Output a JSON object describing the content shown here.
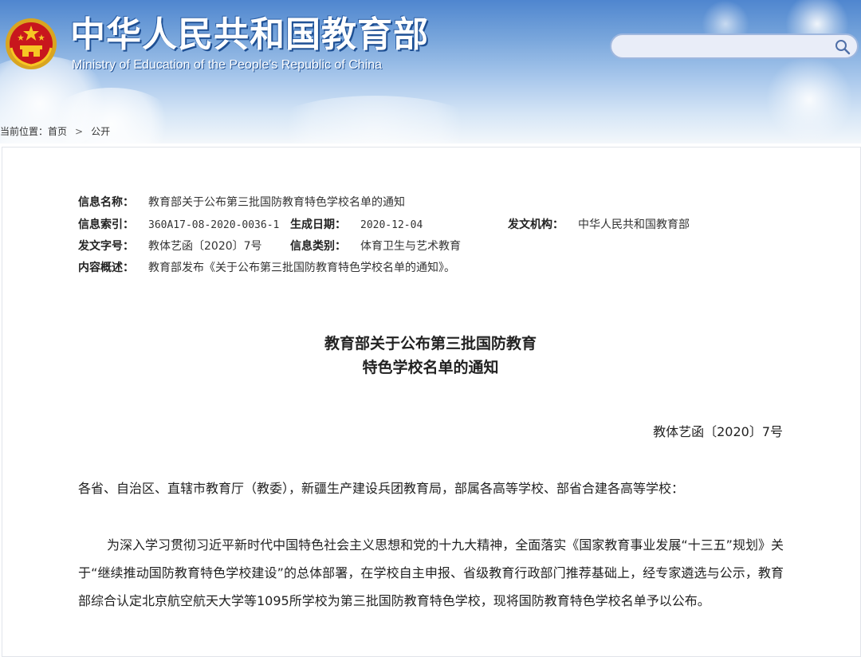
{
  "header": {
    "site_title": "中华人民共和国教育部",
    "site_subtitle": "Ministry of Education of the People's Republic of China",
    "search_placeholder": "",
    "colors": {
      "sky_top": "#4f86cf",
      "sky_bottom": "#f3f7fb",
      "title_shadow": "#1e4f93"
    }
  },
  "breadcrumb": {
    "label": "当前位置：",
    "items": [
      "首页",
      "公开"
    ],
    "separator": ">"
  },
  "meta": {
    "name_label": "信息名称：",
    "name_value": "教育部关于公布第三批国防教育特色学校名单的通知",
    "index_label": "信息索引：",
    "index_value": "360A17-08-2020-0036-1",
    "date_label": "生成日期：",
    "date_value": "2020-12-04",
    "org_label": "发文机构：",
    "org_value": "中华人民共和国教育部",
    "docno_label": "发文字号：",
    "docno_value": "教体艺函〔2020〕7号",
    "category_label": "信息类别：",
    "category_value": "体育卫生与艺术教育",
    "summary_label": "内容概述：",
    "summary_value": "教育部发布《关于公布第三批国防教育特色学校名单的通知》。"
  },
  "document": {
    "title_line1": "教育部关于公布第三批国防教育",
    "title_line2": "特色学校名单的通知",
    "number": "教体艺函〔2020〕7号",
    "addressee": "各省、自治区、直辖市教育厅（教委），新疆生产建设兵团教育局，部属各高等学校、部省合建各高等学校：",
    "paragraph": "为深入学习贯彻习近平新时代中国特色社会主义思想和党的十九大精神，全面落实《国家教育事业发展“十三五”规划》关于“继续推动国防教育特色学校建设”的总体部署，在学校自主申报、省级教育行政部门推荐基础上，经专家遴选与公示，教育部综合认定北京航空航天大学等1095所学校为第三批国防教育特色学校，现将国防教育特色学校名单予以公布。"
  }
}
